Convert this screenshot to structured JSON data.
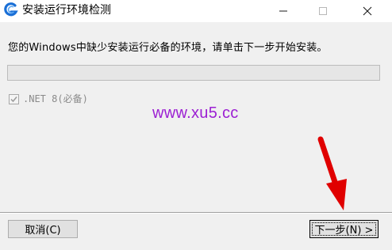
{
  "window": {
    "title": "安装运行环境检测",
    "app_icon": "installer-g-icon",
    "controls": {
      "minimize": "minimize-icon",
      "maximize": "maximize-icon",
      "close": "close-icon"
    }
  },
  "content": {
    "message": "您的Windows中缺少安装运行必备的环境，请单击下一步开始安装。",
    "progress": {
      "value": 0
    },
    "components": [
      {
        "label": ".NET 8(必备)",
        "checked": true,
        "enabled": false
      }
    ]
  },
  "watermark": "www.xu5.cc",
  "buttons": {
    "cancel": "取消(C)",
    "next": "下一步(N) >"
  },
  "annotation": {
    "arrow_color": "#e00000"
  },
  "colors": {
    "watermark": "#9c20d3",
    "dialog_background": "#f0f0f0"
  }
}
